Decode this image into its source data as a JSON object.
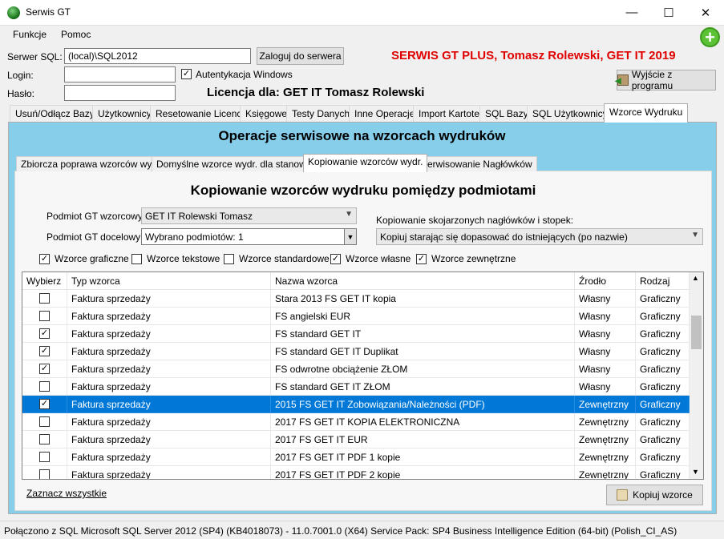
{
  "window": {
    "title": "Serwis GT",
    "minimize": "—",
    "maximize": "☐",
    "close": "✕"
  },
  "menu": {
    "funkcje": "Funkcje",
    "pomoc": "Pomoc"
  },
  "header": {
    "server_label": "Serwer SQL:",
    "server_value": "(local)\\SQL2012",
    "login_button": "Zaloguj do serwera",
    "login_label": "Login:",
    "password_label": "Hasło:",
    "windows_auth_label": "Autentykacja Windows",
    "windows_auth_checked": true,
    "product_title": "SERWIS GT PLUS, Tomasz Rolewski, GET IT 2019",
    "license": "Licencja dla: GET IT Tomasz Rolewski",
    "exit_button": "Wyjście z programu"
  },
  "tabs": [
    "Usuń/Odłącz Bazy",
    "Użytkownicy",
    "Resetowanie Licencji",
    "Księgowe",
    "Testy Danych",
    "Inne Operacje",
    "Import Kartotek",
    "SQL Bazy",
    "SQL Użytkownicy",
    "Wzorce Wydruku"
  ],
  "panel_title": "Operacje serwisowe na wzorcach wydruków",
  "subtabs": [
    "Zbiorcza poprawa wzorców wydr.",
    "Domyślne wzorce wydr. dla stanowisk",
    "Kopiowanie wzorców wydr.",
    "Serwisowanie Nagłówków"
  ],
  "copy": {
    "title": "Kopiowanie wzorców wydruku pomiędzy podmiotami",
    "source_label": "Podmiot GT wzorcowy:",
    "source_value": "GET IT Rolewski Tomasz",
    "target_label": "Podmiot GT docelowy:",
    "target_value": "Wybrano podmiotów: 1",
    "headers_label": "Kopiowanie skojarzonych nagłówków i stopek:",
    "headers_value": "Kopiuj starając się dopasować do istniejących (po nazwie)",
    "filters": [
      {
        "label": "Wzorce graficzne",
        "checked": "✓"
      },
      {
        "label": "Wzorce tekstowe",
        "checked": ""
      },
      {
        "label": "Wzorce standardowe",
        "checked": ""
      },
      {
        "label": "Wzorce własne",
        "checked": "✓"
      },
      {
        "label": "Wzorce zewnętrzne",
        "checked": "✓"
      }
    ],
    "select_all": "Zaznacz wszystkie",
    "copy_button": "Kopiuj wzorce"
  },
  "grid": {
    "columns": [
      "Wybierz",
      "Typ wzorca",
      "Nazwa wzorca",
      "Źrodło",
      "Rodzaj"
    ],
    "rows": [
      {
        "check": "",
        "typ": "Faktura sprzedaży",
        "nazwa": "Stara 2013 FS GET IT kopia",
        "zrodlo": "Własny",
        "rodzaj": "Graficzny"
      },
      {
        "check": "",
        "typ": "Faktura sprzedaży",
        "nazwa": "FS angielski EUR",
        "zrodlo": "Własny",
        "rodzaj": "Graficzny"
      },
      {
        "check": "✓",
        "typ": "Faktura sprzedaży",
        "nazwa": "FS standard GET IT",
        "zrodlo": "Własny",
        "rodzaj": "Graficzny"
      },
      {
        "check": "✓",
        "typ": "Faktura sprzedaży",
        "nazwa": "FS standard GET IT Duplikat",
        "zrodlo": "Własny",
        "rodzaj": "Graficzny"
      },
      {
        "check": "✓",
        "typ": "Faktura sprzedaży",
        "nazwa": "FS odwrotne obciążenie ZŁOM",
        "zrodlo": "Własny",
        "rodzaj": "Graficzny"
      },
      {
        "check": "",
        "typ": "Faktura sprzedaży",
        "nazwa": "FS standard GET IT ZŁOM",
        "zrodlo": "Własny",
        "rodzaj": "Graficzny"
      },
      {
        "check": "✓",
        "typ": "Faktura sprzedaży",
        "nazwa": "2015 FS GET IT Zobowiązania/Należności (PDF)",
        "zrodlo": "Zewnętrzny",
        "rodzaj": "Graficzny"
      },
      {
        "check": "",
        "typ": "Faktura sprzedaży",
        "nazwa": "2017 FS GET IT KOPIA ELEKTRONICZNA",
        "zrodlo": "Zewnętrzny",
        "rodzaj": "Graficzny"
      },
      {
        "check": "",
        "typ": "Faktura sprzedaży",
        "nazwa": "2017 FS GET IT EUR",
        "zrodlo": "Zewnętrzny",
        "rodzaj": "Graficzny"
      },
      {
        "check": "",
        "typ": "Faktura sprzedaży",
        "nazwa": "2017 FS GET IT PDF 1 kopie",
        "zrodlo": "Zewnętrzny",
        "rodzaj": "Graficzny"
      },
      {
        "check": "",
        "typ": "Faktura sprzedaży",
        "nazwa": "2017 FS GET IT PDF 2 kopie",
        "zrodlo": "Zewnętrzny",
        "rodzaj": "Graficzny"
      }
    ],
    "selected_row": 6
  },
  "status": "Połączono z SQL  Microsoft SQL Server 2012 (SP4) (KB4018073) - 11.0.7001.0 (X64)  Service Pack: SP4 Business Intelligence Edition (64-bit) (Polish_CI_AS)",
  "colors": {
    "accent": "#0078d7",
    "panel": "#87ceeb",
    "title_red": "#e00000"
  }
}
